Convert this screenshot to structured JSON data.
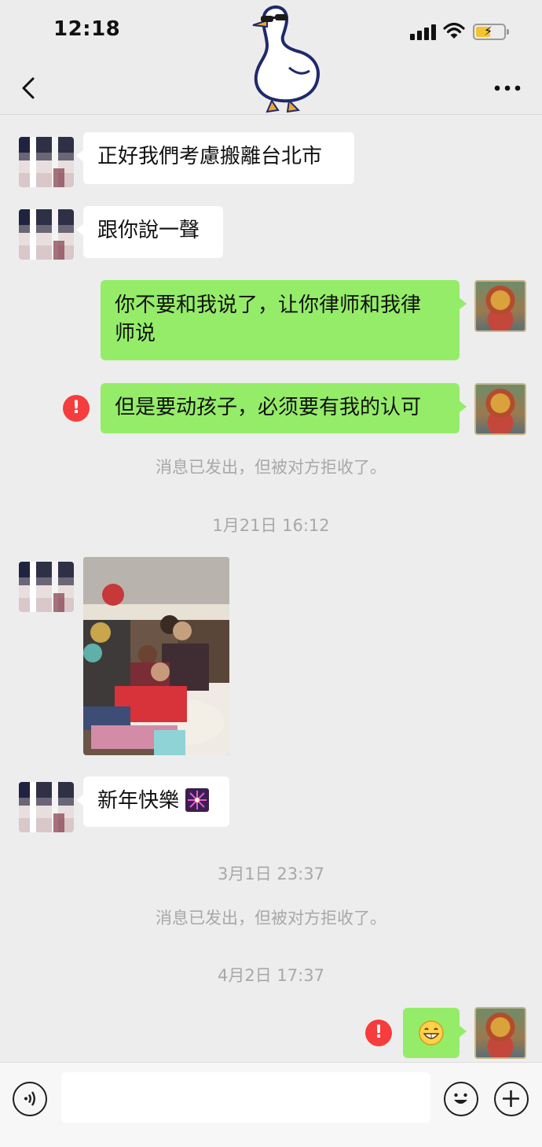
{
  "status_bar": {
    "time": "12:18"
  },
  "messages": [
    {
      "side": "left",
      "text": "正好我們考慮搬離台北市"
    },
    {
      "side": "left",
      "text": "跟你說一聲"
    },
    {
      "side": "right",
      "text": "你不要和我说了，让你律师和我律师说",
      "line1": "你不要和我说了，让你律师和我律",
      "line2": "师说"
    },
    {
      "side": "right",
      "text": "但是要动孩子，必须要有我的认可",
      "failed": true
    },
    {
      "side": "system",
      "text": "消息已发出，但被对方拒收了。"
    },
    {
      "side": "timestamp",
      "text": "1月21日 16:12"
    },
    {
      "side": "left",
      "type": "image"
    },
    {
      "side": "left",
      "text": "新年快樂",
      "emoji": "fireworks-emoji"
    },
    {
      "side": "timestamp",
      "text": "3月1日 23:37"
    },
    {
      "side": "system",
      "text": "消息已发出，但被对方拒收了。"
    },
    {
      "side": "timestamp",
      "text": "4月2日 17:37"
    },
    {
      "side": "right",
      "type": "emoji",
      "emoji": "grin-emoji",
      "failed": true
    }
  ],
  "error_mark": "!",
  "colors": {
    "sent_bubble": "#95ec69",
    "received_bubble": "#ffffff",
    "error": "#f53d3d",
    "background": "#ededed"
  }
}
